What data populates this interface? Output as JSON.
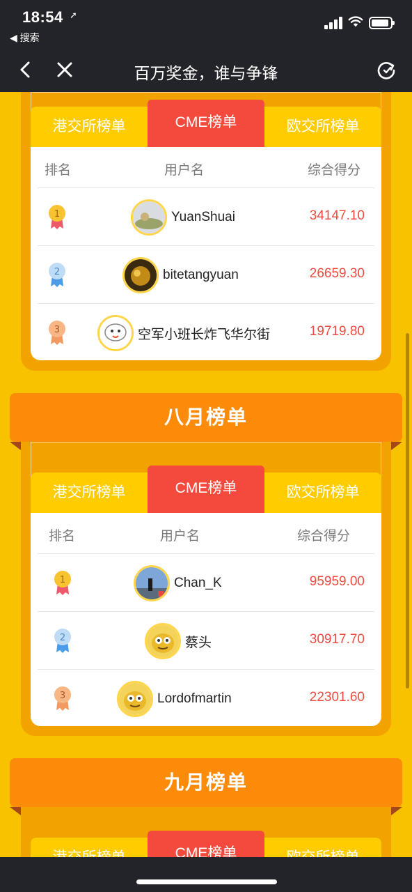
{
  "status_bar": {
    "time": "18:54",
    "back_app": "◀ 搜索"
  },
  "nav": {
    "title": "百万奖金，谁与争锋"
  },
  "colors": {
    "background": "#f9c200",
    "accent_red": "#f44a3e",
    "orange": "#fb8b08",
    "score": "#ef4b3f"
  },
  "icons": [
    "location-arrow-icon",
    "signal-icon",
    "wifi-icon",
    "battery-icon",
    "chevron-left-icon",
    "close-icon",
    "refresh-icon",
    "medal-gold-icon",
    "medal-silver-icon",
    "medal-bronze-icon"
  ],
  "tabs": {
    "hkex": "港交所榜单",
    "cme": "CME榜单",
    "euro": "欧交所榜单"
  },
  "table_headers": {
    "rank": "排名",
    "username": "用户名",
    "score": "综合得分"
  },
  "boards": [
    {
      "title": "",
      "rows": [
        {
          "rank": "1",
          "name": "YuanShuai",
          "score": "34147.10"
        },
        {
          "rank": "2",
          "name": "bitetangyuan",
          "score": "26659.30"
        },
        {
          "rank": "3",
          "name": "空军小班长炸飞华尔街",
          "score": "19719.80"
        }
      ]
    },
    {
      "title": "八月榜单",
      "rows": [
        {
          "rank": "1",
          "name": "Chan_K",
          "score": "95959.00"
        },
        {
          "rank": "2",
          "name": "蔡头",
          "score": "30917.70"
        },
        {
          "rank": "3",
          "name": "Lordofmartin",
          "score": "22301.60"
        }
      ]
    },
    {
      "title": "九月榜单"
    }
  ]
}
